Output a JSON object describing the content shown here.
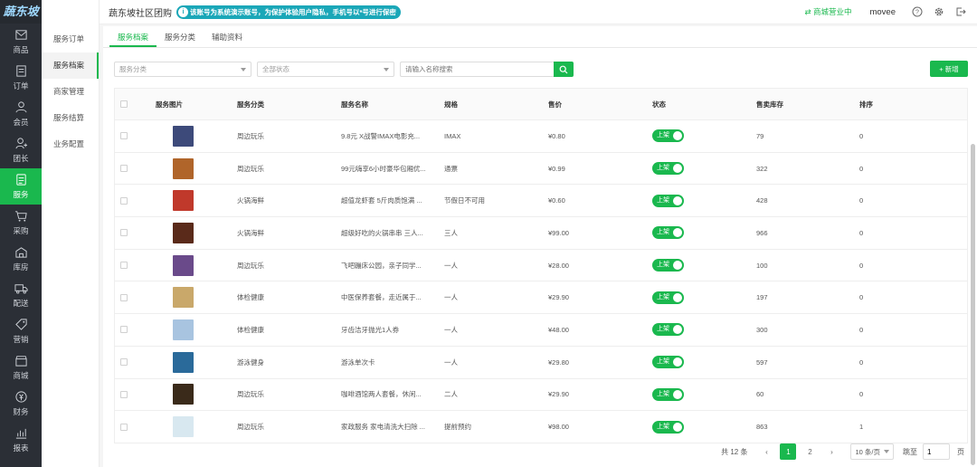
{
  "app": {
    "logo": "蔬东坡",
    "title": "蔬东坡社区团购",
    "notice": "该账号为系统演示账号，为保护体验用户隐私，手机号以*号进行保密",
    "notice_icon": "i"
  },
  "header": {
    "shop_status": "商城营业中",
    "user": "movee"
  },
  "nav": [
    {
      "label": "商品",
      "icon": "mail-icon"
    },
    {
      "label": "订单",
      "icon": "order-icon"
    },
    {
      "label": "会员",
      "icon": "member-icon"
    },
    {
      "label": "团长",
      "icon": "leader-icon"
    },
    {
      "label": "服务",
      "icon": "service-icon",
      "active": true
    },
    {
      "label": "采购",
      "icon": "cart-icon"
    },
    {
      "label": "库房",
      "icon": "warehouse-icon"
    },
    {
      "label": "配送",
      "icon": "truck-icon"
    },
    {
      "label": "营销",
      "icon": "tag-icon"
    },
    {
      "label": "商城",
      "icon": "store-icon"
    },
    {
      "label": "财务",
      "icon": "finance-icon"
    },
    {
      "label": "报表",
      "icon": "chart-icon"
    }
  ],
  "submenu": [
    "服务订单",
    "服务档案",
    "商家管理",
    "服务结算",
    "业务配置"
  ],
  "tabs": [
    "服务档案",
    "服务分类",
    "辅助资料"
  ],
  "filters": {
    "category_placeholder": "服务分类",
    "status_placeholder": "全部状态",
    "search_placeholder": "请输入名称搜索"
  },
  "add_label": "+ 新增",
  "table": {
    "headers": [
      "服务图片",
      "服务分类",
      "服务名称",
      "规格",
      "售价",
      "状态",
      "售卖库存",
      "排序"
    ],
    "rows": [
      {
        "category": "周边玩乐",
        "name": "9.8元 X战警IMAX电影充...",
        "spec": "IMAX",
        "price": "¥0.80",
        "status": "上架",
        "stock": "79",
        "sort": "0",
        "thumb": "#3d4a7a"
      },
      {
        "category": "周边玩乐",
        "name": "99元嗨享6小时豪华包厢优...",
        "spec": "通票",
        "price": "¥0.99",
        "status": "上架",
        "stock": "322",
        "sort": "0",
        "thumb": "#b0652a"
      },
      {
        "category": "火锅海鲜",
        "name": "超值龙虾套 5斤肉质饱满 ...",
        "spec": "节假日不可用",
        "price": "¥0.60",
        "status": "上架",
        "stock": "428",
        "sort": "0",
        "thumb": "#c0392b"
      },
      {
        "category": "火锅海鲜",
        "name": "超级好吃的火锅串串 三人...",
        "spec": "三人",
        "price": "¥99.00",
        "status": "上架",
        "stock": "966",
        "sort": "0",
        "thumb": "#5a2a1a"
      },
      {
        "category": "周边玩乐",
        "name": "飞吧蹦床公园，亲子同学...",
        "spec": "一人",
        "price": "¥28.00",
        "status": "上架",
        "stock": "100",
        "sort": "0",
        "thumb": "#6a4a8a"
      },
      {
        "category": "体检健康",
        "name": "中医保养套餐，走近属于...",
        "spec": "一人",
        "price": "¥29.90",
        "status": "上架",
        "stock": "197",
        "sort": "0",
        "thumb": "#c9a86a"
      },
      {
        "category": "体检健康",
        "name": "牙齿洁牙抛光1人券",
        "spec": "一人",
        "price": "¥48.00",
        "status": "上架",
        "stock": "300",
        "sort": "0",
        "thumb": "#a8c4e0"
      },
      {
        "category": "游泳健身",
        "name": "游泳单次卡",
        "spec": "一人",
        "price": "¥29.80",
        "status": "上架",
        "stock": "597",
        "sort": "0",
        "thumb": "#2a6a9a"
      },
      {
        "category": "周边玩乐",
        "name": "咖啡酒馆两人套餐，休闲...",
        "spec": "二人",
        "price": "¥29.90",
        "status": "上架",
        "stock": "60",
        "sort": "0",
        "thumb": "#3a2a1a"
      },
      {
        "category": "周边玩乐",
        "name": "家政服务 家电清洗大扫除 ...",
        "spec": "提前预约",
        "price": "¥98.00",
        "status": "上架",
        "stock": "863",
        "sort": "1",
        "thumb": "#d8e8f0"
      }
    ]
  },
  "pager": {
    "total": "共 12 条",
    "pages": [
      "1",
      "2"
    ],
    "page_size": "10 条/页",
    "jump_label": "跳至",
    "jump_value": "1",
    "page_suffix": "页",
    "prev": "‹",
    "next": "›"
  }
}
